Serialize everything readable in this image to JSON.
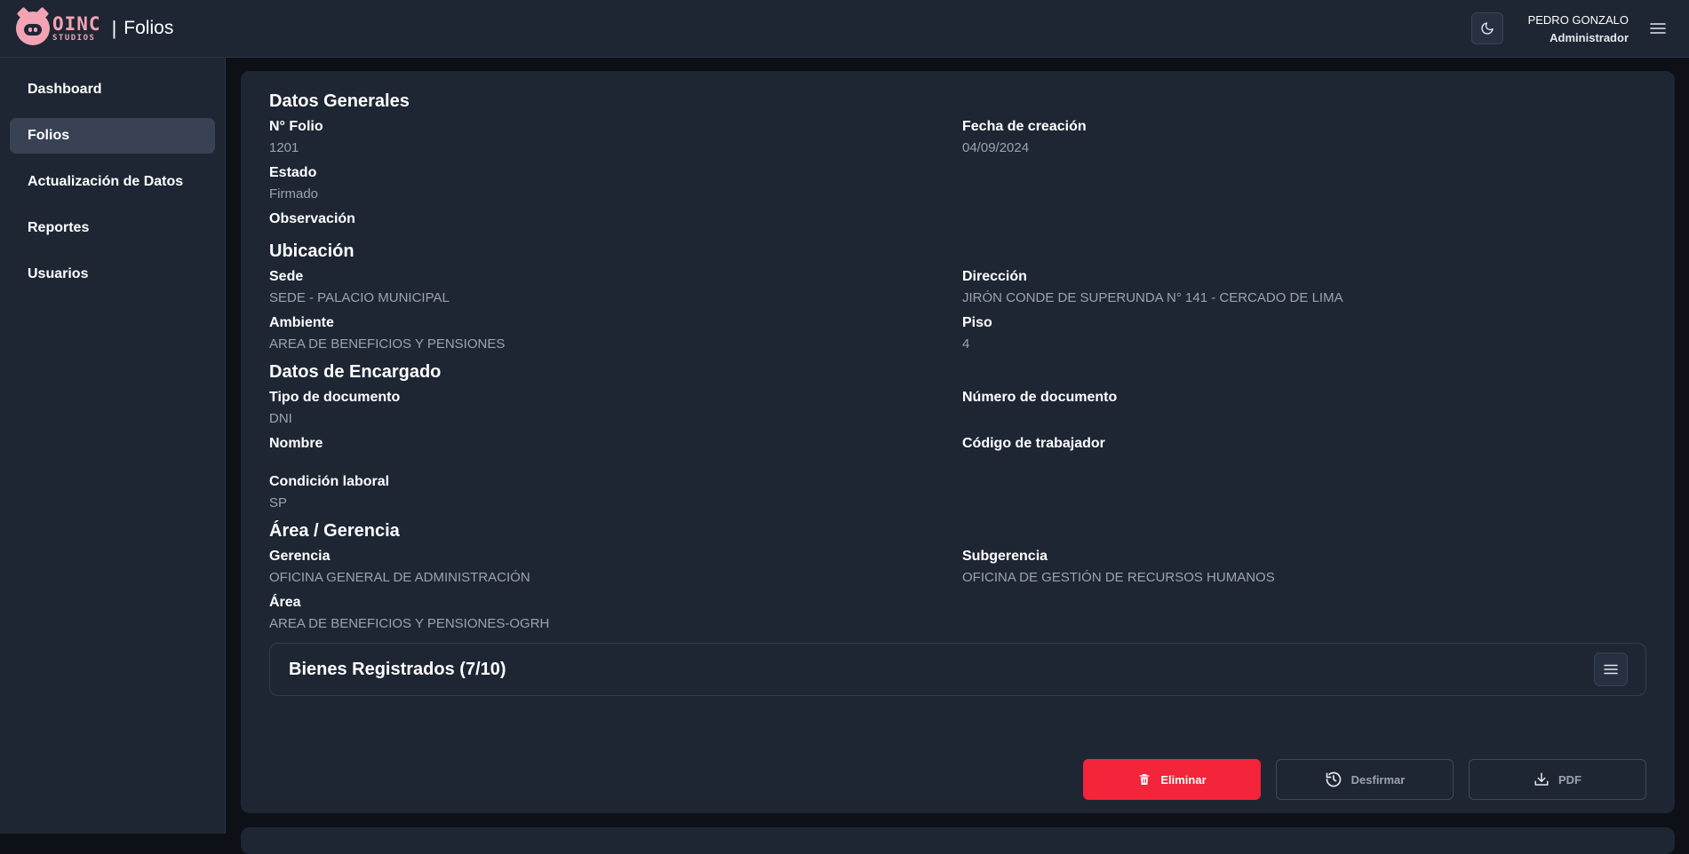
{
  "header": {
    "brand_top": "OINC",
    "brand_bottom": "STUDIOS",
    "separator": "|",
    "title": "Folios",
    "user_name": "PEDRO GONZALO",
    "user_role": "Administrador",
    "icons": {
      "theme": "moon-icon",
      "menu": "hamburger-menu-icon"
    }
  },
  "sidebar": {
    "items": [
      {
        "label": "Dashboard",
        "active": false
      },
      {
        "label": "Folios",
        "active": true
      },
      {
        "label": "Actualización de Datos",
        "active": false
      },
      {
        "label": "Reportes",
        "active": false
      },
      {
        "label": "Usuarios",
        "active": false
      }
    ]
  },
  "datos_generales": {
    "title": "Datos Generales",
    "folio_label": "N° Folio",
    "folio_value": "1201",
    "fecha_label": "Fecha de creación",
    "fecha_value": "04/09/2024",
    "estado_label": "Estado",
    "estado_value": "Firmado",
    "observacion_label": "Observación",
    "observacion_value": ""
  },
  "ubicacion": {
    "title": "Ubicación",
    "sede_label": "Sede",
    "sede_value": "SEDE - PALACIO MUNICIPAL",
    "direccion_label": "Dirección",
    "direccion_value": "JIRÓN CONDE DE SUPERUNDA N° 141 - CERCADO DE LIMA",
    "ambiente_label": "Ambiente",
    "ambiente_value": "AREA DE BENEFICIOS Y PENSIONES",
    "piso_label": "Piso",
    "piso_value": "4"
  },
  "encargado": {
    "title": "Datos de Encargado",
    "tipo_doc_label": "Tipo de documento",
    "tipo_doc_value": "DNI",
    "num_doc_label": "Número de documento",
    "num_doc_value": "",
    "nombre_label": "Nombre",
    "nombre_value": "",
    "codigo_label": "Código de trabajador",
    "codigo_value": "",
    "condicion_label": "Condición laboral",
    "condicion_value": "SP"
  },
  "area_gerencia": {
    "title": "Área / Gerencia",
    "gerencia_label": "Gerencia",
    "gerencia_value": "OFICINA GENERAL DE ADMINISTRACIÓN",
    "subgerencia_label": "Subgerencia",
    "subgerencia_value": "OFICINA DE GESTIÓN DE RECURSOS HUMANOS",
    "area_label": "Área",
    "area_value": "AREA DE BENEFICIOS Y PENSIONES-OGRH"
  },
  "bienes": {
    "title": "Bienes Registrados (7/10)",
    "toggle_icon": "menu-icon"
  },
  "actions": {
    "eliminar": "Eliminar",
    "desfirmar": "Desfirmar",
    "pdf": "PDF"
  },
  "colors": {
    "danger": "#f4243a",
    "brand": "#f2a3b4",
    "surface": "#1e2634",
    "active_nav": "#394254"
  }
}
